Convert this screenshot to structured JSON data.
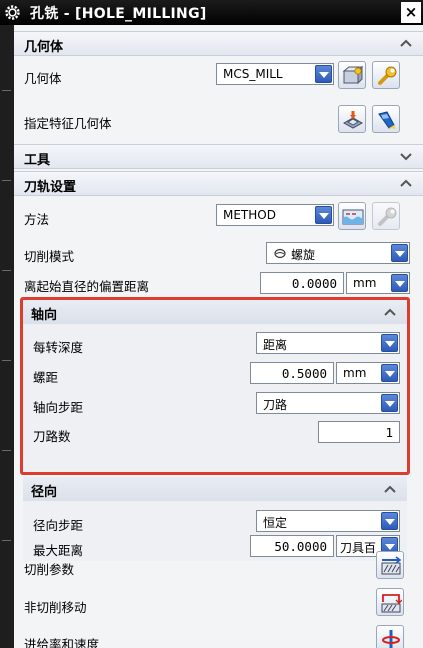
{
  "title": "孔铣 - [HOLE_MILLING]",
  "close_symbol": "×",
  "sections": {
    "geometry": "几何体",
    "tool": "工具",
    "path_settings": "刀轨设置"
  },
  "geometry": {
    "label": "几何体",
    "value": "MCS_MILL",
    "feature_label": "指定特征几何体"
  },
  "path": {
    "method_label": "方法",
    "method_value": "METHOD",
    "cut_mode_label": "切削模式",
    "cut_mode_value": "螺旋",
    "offset_label": "离起始直径的偏置距离",
    "offset_value": "0.0000",
    "offset_unit": "mm"
  },
  "axial": {
    "title": "轴向",
    "depth_label": "每转深度",
    "depth_value": "距离",
    "pitch_label": "螺距",
    "pitch_value": "0.5000",
    "pitch_unit": "mm",
    "step_label": "轴向步距",
    "step_value": "刀路",
    "count_label": "刀路数",
    "count_value": "1"
  },
  "radial": {
    "title": "径向",
    "step_label": "径向步距",
    "step_value": "恒定",
    "max_label": "最大距离",
    "max_value": "50.0000",
    "max_unit": "刀具百"
  },
  "bottom": {
    "cut_params": "切削参数",
    "non_cut": "非切削移动",
    "feeds": "进给率和速度"
  },
  "colors": {
    "highlight_box": "#e03b2f",
    "dropdown_arrow": "#2d5bb8"
  }
}
